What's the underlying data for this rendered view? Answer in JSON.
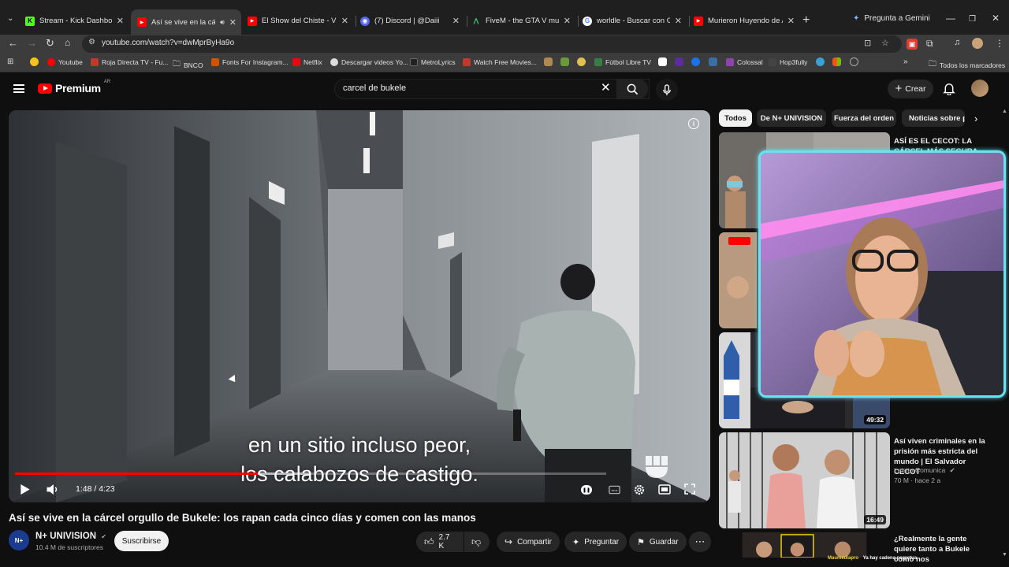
{
  "browser": {
    "tabs": [
      {
        "title": "Stream - Kick Dashboard",
        "fav_color": "#53fc18",
        "fav_glyph": "K"
      },
      {
        "title": "Así se vive en la cárcel",
        "fav_color": "#ff0000",
        "fav_glyph": "▶",
        "active": true
      },
      {
        "title": "El Show del Chiste - VIDEO",
        "fav_color": "#ff0000",
        "fav_glyph": "▶"
      },
      {
        "title": "(7) Discord | @Daiii",
        "fav_color": "#5865f2",
        "fav_glyph": "◉"
      },
      {
        "title": "FiveM - the GTA V multipl",
        "fav_color": "#1b1b1b",
        "fav_glyph": "⋀"
      },
      {
        "title": "worldle - Buscar con Goog",
        "fav_color": "#ffffff",
        "fav_glyph": "G"
      },
      {
        "title": "Murieron Huyendo de Alg",
        "fav_color": "#ff0000",
        "fav_glyph": "▶"
      }
    ],
    "gemini_label": "Pregunta a Gemini",
    "url": "youtube.com/watch?v=dwMprByHa9o",
    "bookmarks": [
      {
        "label": "Youtube",
        "color": "#ff0000"
      },
      {
        "label": "Roja Directa TV - Fu...",
        "color": "#c0392b"
      },
      {
        "label": "BNCO",
        "color": "#888888"
      },
      {
        "label": "Fonts For Instagram...",
        "color": "#d35400"
      },
      {
        "label": "Netflix",
        "color": "#e50914"
      },
      {
        "label": "Descargar videos Yo...",
        "color": "#dddddd"
      },
      {
        "label": "MetroLyrics",
        "color": "#222222"
      },
      {
        "label": "Watch Free Movies...",
        "color": "#c0392b"
      },
      {
        "label": "Fútbol Libre TV",
        "color": "#3a7d44"
      },
      {
        "label": "Colossal",
        "color": "#8e44ad"
      },
      {
        "label": "Hop3fully",
        "color": "#444444"
      }
    ],
    "all_bookmarks_label": "Todos los marcadores"
  },
  "youtube": {
    "logo_text": "Premium",
    "country_code": "AR",
    "search_value": "carcel de bukele",
    "create_label": "Crear"
  },
  "player": {
    "caption_line1": "en un sitio incluso peor,",
    "caption_line2": "los calabozos de castigo.",
    "time_display": "1:48 / 4:23",
    "progress_played_fraction": 0.41,
    "progress_buffered_fraction": 0.5
  },
  "video": {
    "title": "Así se vive en la cárcel orgullo de Bukele: los rapan cada cinco días y comen con las manos",
    "channel_name": "N+ UNIVISION",
    "channel_avatar_text": "N+",
    "subscribers": "10.4 M de suscriptores",
    "subscribe_label": "Suscribirse",
    "likes": "2.7 K",
    "share_label": "Compartir",
    "ask_label": "Preguntar",
    "save_label": "Guardar"
  },
  "sidebar": {
    "chips": [
      "Todos",
      "De N+ UNIVISION",
      "Fuerza del orden",
      "Noticias sobre p"
    ],
    "recommendations": [
      {
        "title": "ASÍ ES EL CECOT: LA CÁRCEL MÁS SEGURA DEL",
        "channel": "",
        "meta": "",
        "duration": ""
      },
      {
        "title": "",
        "channel": "",
        "meta": "",
        "duration": ""
      },
      {
        "title": "",
        "channel": "",
        "meta": "",
        "duration": "49:32"
      },
      {
        "title": "Así viven criminales en la prisión más estricta del mundo | El Salvador CECOT",
        "channel": "Luisito Comunica",
        "meta": "70 M · hace 2 a",
        "duration": "16:49"
      },
      {
        "title": "¿Realmente la gente quiere tanto a Bukele como nos",
        "channel": "",
        "meta": "",
        "duration": ""
      }
    ]
  },
  "overlay": {
    "ticker_name": "Maumediapro",
    "ticker_text": "Ya hay cadena perpetua"
  },
  "colors": {
    "accent": "#ff0000",
    "webcam_border": "#68e4ee",
    "background": "#0f0f0f"
  }
}
